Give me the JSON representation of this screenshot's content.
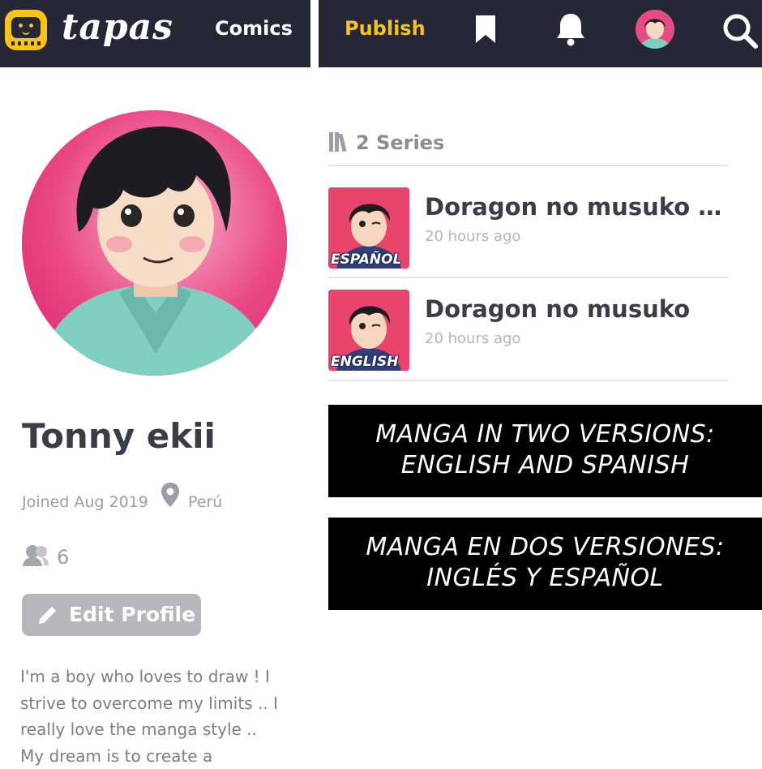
{
  "header": {
    "logo_text": "tapas",
    "comics_label": "Comics",
    "publish_label": "Publish"
  },
  "colors": {
    "header_bg": "#252736",
    "brand_yellow": "#f6c31c",
    "avatar_pink": "#e94985"
  },
  "icons": [
    "tapas-logo-icon",
    "bookmark-icon",
    "bell-icon",
    "avatar-icon",
    "search-icon",
    "location-pin-icon",
    "subscribers-icon",
    "pencil-icon",
    "library-icon"
  ],
  "profile": {
    "name": "Tonny ekii",
    "joined": "Joined Aug 2019",
    "location": "Perú",
    "subscribers": "6",
    "edit_label": "Edit Profile",
    "bio": "I'm a boy who loves to draw ! I\nstrive to overcome my limits .. I\nreally love the manga style ..\nMy dream is to create a"
  },
  "series": {
    "count_label": "2 Series",
    "items": [
      {
        "title": "Doragon no musuko - …",
        "time": "20 hours ago",
        "tag": "ESPAÑOL"
      },
      {
        "title": "Doragon no musuko",
        "time": "20 hours ago",
        "tag": "ENGLISH"
      }
    ]
  },
  "banners": [
    {
      "line1": "MANGA IN TWO VERSIONS:",
      "line2": "ENGLISH AND SPANISH"
    },
    {
      "line1": "MANGA EN DOS VERSIONES:",
      "line2": "INGLÉS Y ESPAÑOL"
    }
  ]
}
